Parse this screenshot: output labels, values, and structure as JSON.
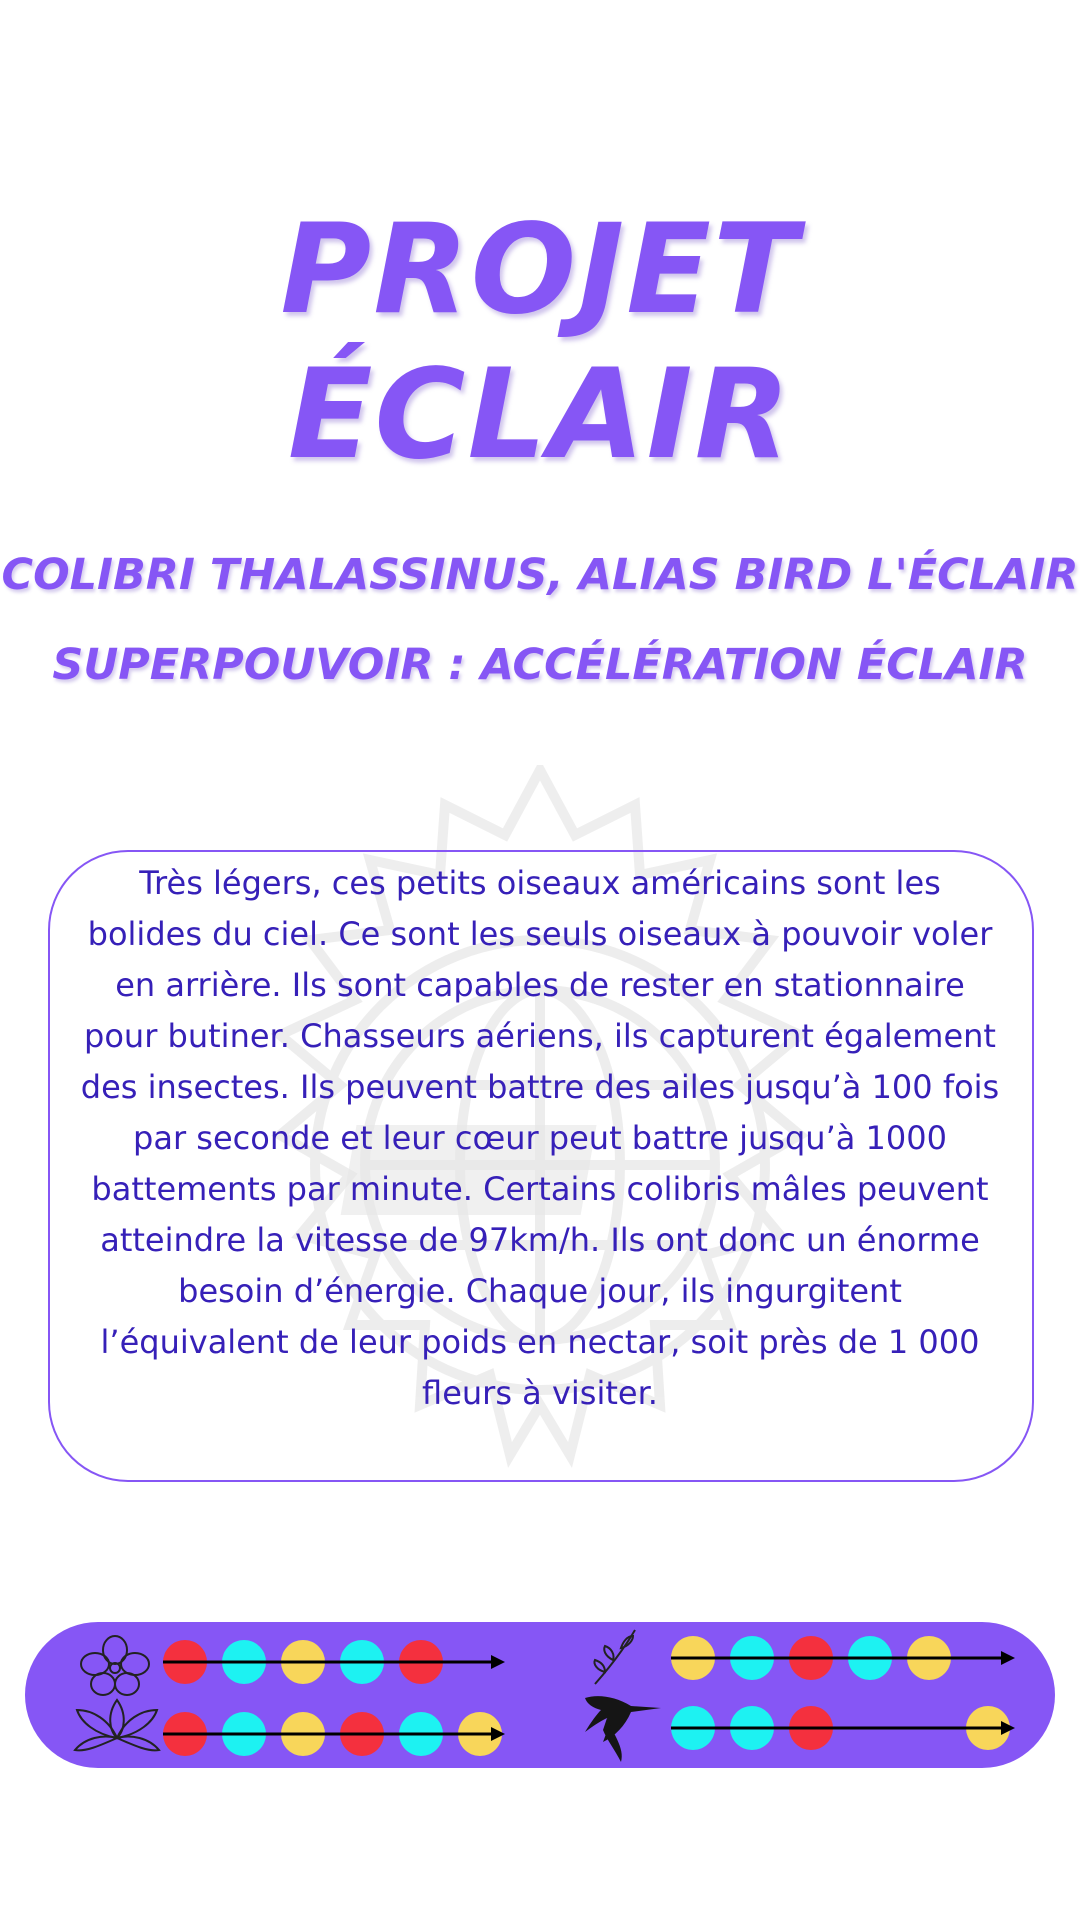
{
  "title": {
    "line1": "PROJET",
    "line2": "ÉCLAIR"
  },
  "subtitle": {
    "line1": "COLIBRI THALASSINUS, ALIAS BIRD L'ÉCLAIR",
    "line2": "SUPERPOUVOIR : ACCÉLÉRATION ÉCLAIR"
  },
  "description": "Très légers, ces petits oiseaux américains sont les bolides du ciel. Ce sont les seuls oiseaux à pouvoir voler en arrière. Ils sont capables de rester en stationnaire pour butiner. Chasseurs aériens, ils capturent également des insectes. Ils peuvent battre des ailes jusqu’à 100 fois par seconde et leur cœur peut battre jusqu’à 1000 battements par minute. Certains colibris mâles peuvent atteindre la vitesse de 97km/h. Ils ont donc un énorme besoin d’énergie. Chaque jour, ils ingurgitent l’équivalent de leur poids en nectar, soit près de 1 000 fleurs à visiter.",
  "colors": {
    "accent": "#8656f5",
    "text": "#3620b8",
    "dot_red": "#f4303e",
    "dot_cyan": "#1df2f2",
    "dot_yellow": "#f8d65a"
  },
  "sequences": [
    {
      "icon": "hibiscus-flower-icon",
      "dots": [
        "red",
        "cyan",
        "yellow",
        "cyan",
        "red"
      ]
    },
    {
      "icon": "lotus-flower-icon",
      "dots": [
        "red",
        "cyan",
        "yellow",
        "red",
        "cyan",
        "yellow"
      ]
    },
    {
      "icon": "leaf-sprig-icon",
      "dots": [
        "yellow",
        "cyan",
        "red",
        "cyan",
        "yellow"
      ]
    },
    {
      "icon": "hummingbird-icon",
      "dots": [
        "cyan",
        "cyan",
        "red",
        "",
        "",
        "yellow"
      ]
    }
  ]
}
